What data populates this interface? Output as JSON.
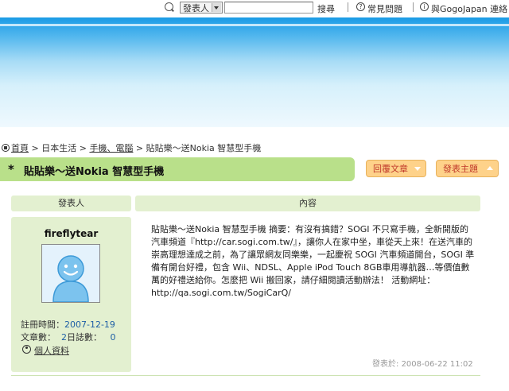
{
  "topbar": {
    "search_select": "發表人",
    "search_value": "",
    "search_button": "搜尋",
    "help_link": "常見問題",
    "japan_link": "與GogoJapan 連絡"
  },
  "breadcrumb": {
    "home": "首頁",
    "sep1": " > ",
    "cat1": "日本生活",
    "sep2": " > ",
    "cat2": "手機、電腦",
    "sep3": " > ",
    "current": "貼貼樂～送Nokia 智慧型手機"
  },
  "thread": {
    "star": "*",
    "title": "貼貼樂～送Nokia 智慧型手機",
    "reply_button": "回覆文章",
    "new_button": "發表主題"
  },
  "table": {
    "author_header": "發表人",
    "content_header": "內容"
  },
  "author": {
    "name": "fireflytear",
    "reg_label": "註冊時間：",
    "reg_value": "2007-12-19",
    "posts_label": "文章數：",
    "posts_value": "2",
    "diary_label": "日誌數：",
    "diary_value": "0",
    "profile_link": "個人資料"
  },
  "post": {
    "body": "貼貼樂～送Nokia 智慧型手機 摘要：有沒有搞錯？SOGI 不只寫手機，全新開版的汽車頻道『http://car.sogi.com.tw/』，讓你人在家中坐，車從天上來！在送汽車的崇高理想達成之前，為了讓眾網友同樂樂，一起慶祝 SOGI 汽車頻道開台，SOGI 準備有開台好禮，包含 Wii、NDSL、Apple iPod Touch 8GB車用導航器…等價值數萬的好禮送給你。怎麼把 Wii 搬回家，請仔細閱讀活動辦法！ 活動網址：http://qa.sogi.com.tw/SogiCarQ/",
    "posted_label": "發表於:",
    "posted_time": "2008-06-22 11:02"
  },
  "colors": {
    "accent_green": "#b9e08a",
    "panel_green": "#e3f0d0",
    "button_orange": "#fed28a",
    "link_blue": "#1e5fa6"
  }
}
